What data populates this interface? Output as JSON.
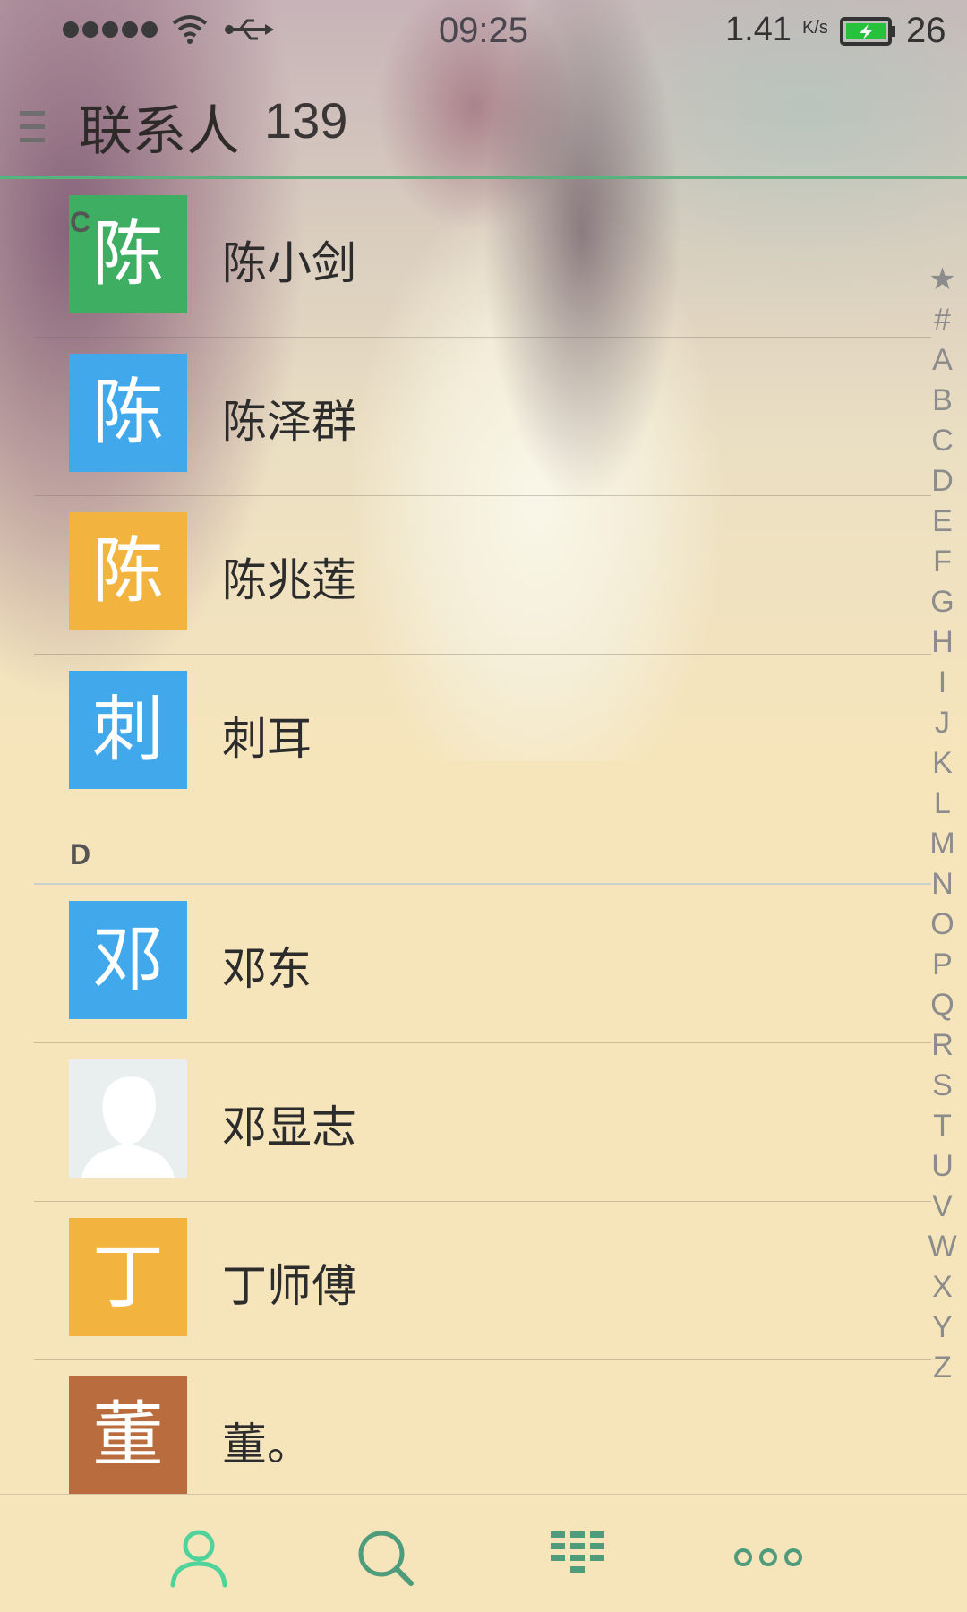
{
  "status_bar": {
    "time": "09:25",
    "net_speed": "1.41",
    "net_unit": "K/s",
    "battery_level": "26",
    "icons": [
      "signal-icon",
      "wifi-icon",
      "usb-icon",
      "battery-charging-icon"
    ]
  },
  "header": {
    "title": "联系人",
    "count": "139"
  },
  "sections": {
    "c": "C",
    "d": "D"
  },
  "contacts": [
    {
      "avatar": "陈",
      "name": "陈小剑",
      "color": "#3dae62"
    },
    {
      "avatar": "陈",
      "name": "陈泽群",
      "color": "#42a8ec"
    },
    {
      "avatar": "陈",
      "name": "陈兆莲",
      "color": "#f3b33f"
    },
    {
      "avatar": "刺",
      "name": "刺耳",
      "color": "#42a8ec"
    },
    {
      "avatar": "邓",
      "name": "邓东",
      "color": "#42a8ec"
    },
    {
      "avatar": "",
      "name": "邓显志",
      "color": "#e9efef"
    },
    {
      "avatar": "丁",
      "name": "丁师傅",
      "color": "#f3b33f"
    },
    {
      "avatar": "董",
      "name": "董。",
      "color": "#b96c3e"
    }
  ],
  "index_letters": [
    "★",
    "#",
    "A",
    "B",
    "C",
    "D",
    "E",
    "F",
    "G",
    "H",
    "I",
    "J",
    "K",
    "L",
    "M",
    "N",
    "O",
    "P",
    "Q",
    "R",
    "S",
    "T",
    "U",
    "V",
    "W",
    "X",
    "Y",
    "Z"
  ],
  "bottom_nav": [
    "contacts-icon",
    "search-icon",
    "dialpad-icon",
    "more-icon"
  ],
  "colors": {
    "accent": "#55b37c",
    "nav_active": "#4fd39a",
    "nav_icon": "#4e9c7c"
  }
}
